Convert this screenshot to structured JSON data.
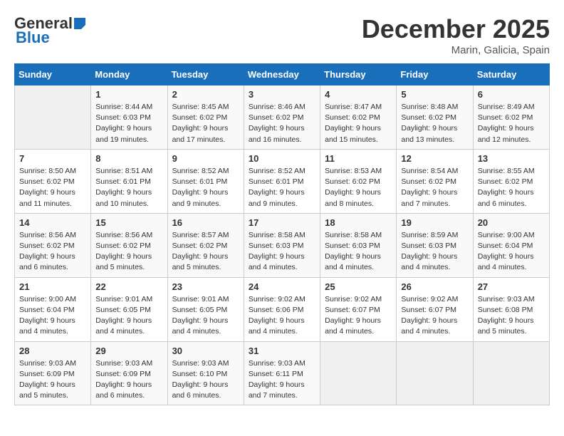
{
  "header": {
    "logo_general": "General",
    "logo_blue": "Blue",
    "month_title": "December 2025",
    "location": "Marin, Galicia, Spain"
  },
  "days_of_week": [
    "Sunday",
    "Monday",
    "Tuesday",
    "Wednesday",
    "Thursday",
    "Friday",
    "Saturday"
  ],
  "weeks": [
    [
      {
        "day": "",
        "sunrise": "",
        "sunset": "",
        "daylight": ""
      },
      {
        "day": "1",
        "sunrise": "Sunrise: 8:44 AM",
        "sunset": "Sunset: 6:03 PM",
        "daylight": "Daylight: 9 hours and 19 minutes."
      },
      {
        "day": "2",
        "sunrise": "Sunrise: 8:45 AM",
        "sunset": "Sunset: 6:02 PM",
        "daylight": "Daylight: 9 hours and 17 minutes."
      },
      {
        "day": "3",
        "sunrise": "Sunrise: 8:46 AM",
        "sunset": "Sunset: 6:02 PM",
        "daylight": "Daylight: 9 hours and 16 minutes."
      },
      {
        "day": "4",
        "sunrise": "Sunrise: 8:47 AM",
        "sunset": "Sunset: 6:02 PM",
        "daylight": "Daylight: 9 hours and 15 minutes."
      },
      {
        "day": "5",
        "sunrise": "Sunrise: 8:48 AM",
        "sunset": "Sunset: 6:02 PM",
        "daylight": "Daylight: 9 hours and 13 minutes."
      },
      {
        "day": "6",
        "sunrise": "Sunrise: 8:49 AM",
        "sunset": "Sunset: 6:02 PM",
        "daylight": "Daylight: 9 hours and 12 minutes."
      }
    ],
    [
      {
        "day": "7",
        "sunrise": "Sunrise: 8:50 AM",
        "sunset": "Sunset: 6:02 PM",
        "daylight": "Daylight: 9 hours and 11 minutes."
      },
      {
        "day": "8",
        "sunrise": "Sunrise: 8:51 AM",
        "sunset": "Sunset: 6:01 PM",
        "daylight": "Daylight: 9 hours and 10 minutes."
      },
      {
        "day": "9",
        "sunrise": "Sunrise: 8:52 AM",
        "sunset": "Sunset: 6:01 PM",
        "daylight": "Daylight: 9 hours and 9 minutes."
      },
      {
        "day": "10",
        "sunrise": "Sunrise: 8:52 AM",
        "sunset": "Sunset: 6:01 PM",
        "daylight": "Daylight: 9 hours and 9 minutes."
      },
      {
        "day": "11",
        "sunrise": "Sunrise: 8:53 AM",
        "sunset": "Sunset: 6:02 PM",
        "daylight": "Daylight: 9 hours and 8 minutes."
      },
      {
        "day": "12",
        "sunrise": "Sunrise: 8:54 AM",
        "sunset": "Sunset: 6:02 PM",
        "daylight": "Daylight: 9 hours and 7 minutes."
      },
      {
        "day": "13",
        "sunrise": "Sunrise: 8:55 AM",
        "sunset": "Sunset: 6:02 PM",
        "daylight": "Daylight: 9 hours and 6 minutes."
      }
    ],
    [
      {
        "day": "14",
        "sunrise": "Sunrise: 8:56 AM",
        "sunset": "Sunset: 6:02 PM",
        "daylight": "Daylight: 9 hours and 6 minutes."
      },
      {
        "day": "15",
        "sunrise": "Sunrise: 8:56 AM",
        "sunset": "Sunset: 6:02 PM",
        "daylight": "Daylight: 9 hours and 5 minutes."
      },
      {
        "day": "16",
        "sunrise": "Sunrise: 8:57 AM",
        "sunset": "Sunset: 6:02 PM",
        "daylight": "Daylight: 9 hours and 5 minutes."
      },
      {
        "day": "17",
        "sunrise": "Sunrise: 8:58 AM",
        "sunset": "Sunset: 6:03 PM",
        "daylight": "Daylight: 9 hours and 4 minutes."
      },
      {
        "day": "18",
        "sunrise": "Sunrise: 8:58 AM",
        "sunset": "Sunset: 6:03 PM",
        "daylight": "Daylight: 9 hours and 4 minutes."
      },
      {
        "day": "19",
        "sunrise": "Sunrise: 8:59 AM",
        "sunset": "Sunset: 6:03 PM",
        "daylight": "Daylight: 9 hours and 4 minutes."
      },
      {
        "day": "20",
        "sunrise": "Sunrise: 9:00 AM",
        "sunset": "Sunset: 6:04 PM",
        "daylight": "Daylight: 9 hours and 4 minutes."
      }
    ],
    [
      {
        "day": "21",
        "sunrise": "Sunrise: 9:00 AM",
        "sunset": "Sunset: 6:04 PM",
        "daylight": "Daylight: 9 hours and 4 minutes."
      },
      {
        "day": "22",
        "sunrise": "Sunrise: 9:01 AM",
        "sunset": "Sunset: 6:05 PM",
        "daylight": "Daylight: 9 hours and 4 minutes."
      },
      {
        "day": "23",
        "sunrise": "Sunrise: 9:01 AM",
        "sunset": "Sunset: 6:05 PM",
        "daylight": "Daylight: 9 hours and 4 minutes."
      },
      {
        "day": "24",
        "sunrise": "Sunrise: 9:02 AM",
        "sunset": "Sunset: 6:06 PM",
        "daylight": "Daylight: 9 hours and 4 minutes."
      },
      {
        "day": "25",
        "sunrise": "Sunrise: 9:02 AM",
        "sunset": "Sunset: 6:07 PM",
        "daylight": "Daylight: 9 hours and 4 minutes."
      },
      {
        "day": "26",
        "sunrise": "Sunrise: 9:02 AM",
        "sunset": "Sunset: 6:07 PM",
        "daylight": "Daylight: 9 hours and 4 minutes."
      },
      {
        "day": "27",
        "sunrise": "Sunrise: 9:03 AM",
        "sunset": "Sunset: 6:08 PM",
        "daylight": "Daylight: 9 hours and 5 minutes."
      }
    ],
    [
      {
        "day": "28",
        "sunrise": "Sunrise: 9:03 AM",
        "sunset": "Sunset: 6:09 PM",
        "daylight": "Daylight: 9 hours and 5 minutes."
      },
      {
        "day": "29",
        "sunrise": "Sunrise: 9:03 AM",
        "sunset": "Sunset: 6:09 PM",
        "daylight": "Daylight: 9 hours and 6 minutes."
      },
      {
        "day": "30",
        "sunrise": "Sunrise: 9:03 AM",
        "sunset": "Sunset: 6:10 PM",
        "daylight": "Daylight: 9 hours and 6 minutes."
      },
      {
        "day": "31",
        "sunrise": "Sunrise: 9:03 AM",
        "sunset": "Sunset: 6:11 PM",
        "daylight": "Daylight: 9 hours and 7 minutes."
      },
      {
        "day": "",
        "sunrise": "",
        "sunset": "",
        "daylight": ""
      },
      {
        "day": "",
        "sunrise": "",
        "sunset": "",
        "daylight": ""
      },
      {
        "day": "",
        "sunrise": "",
        "sunset": "",
        "daylight": ""
      }
    ]
  ]
}
